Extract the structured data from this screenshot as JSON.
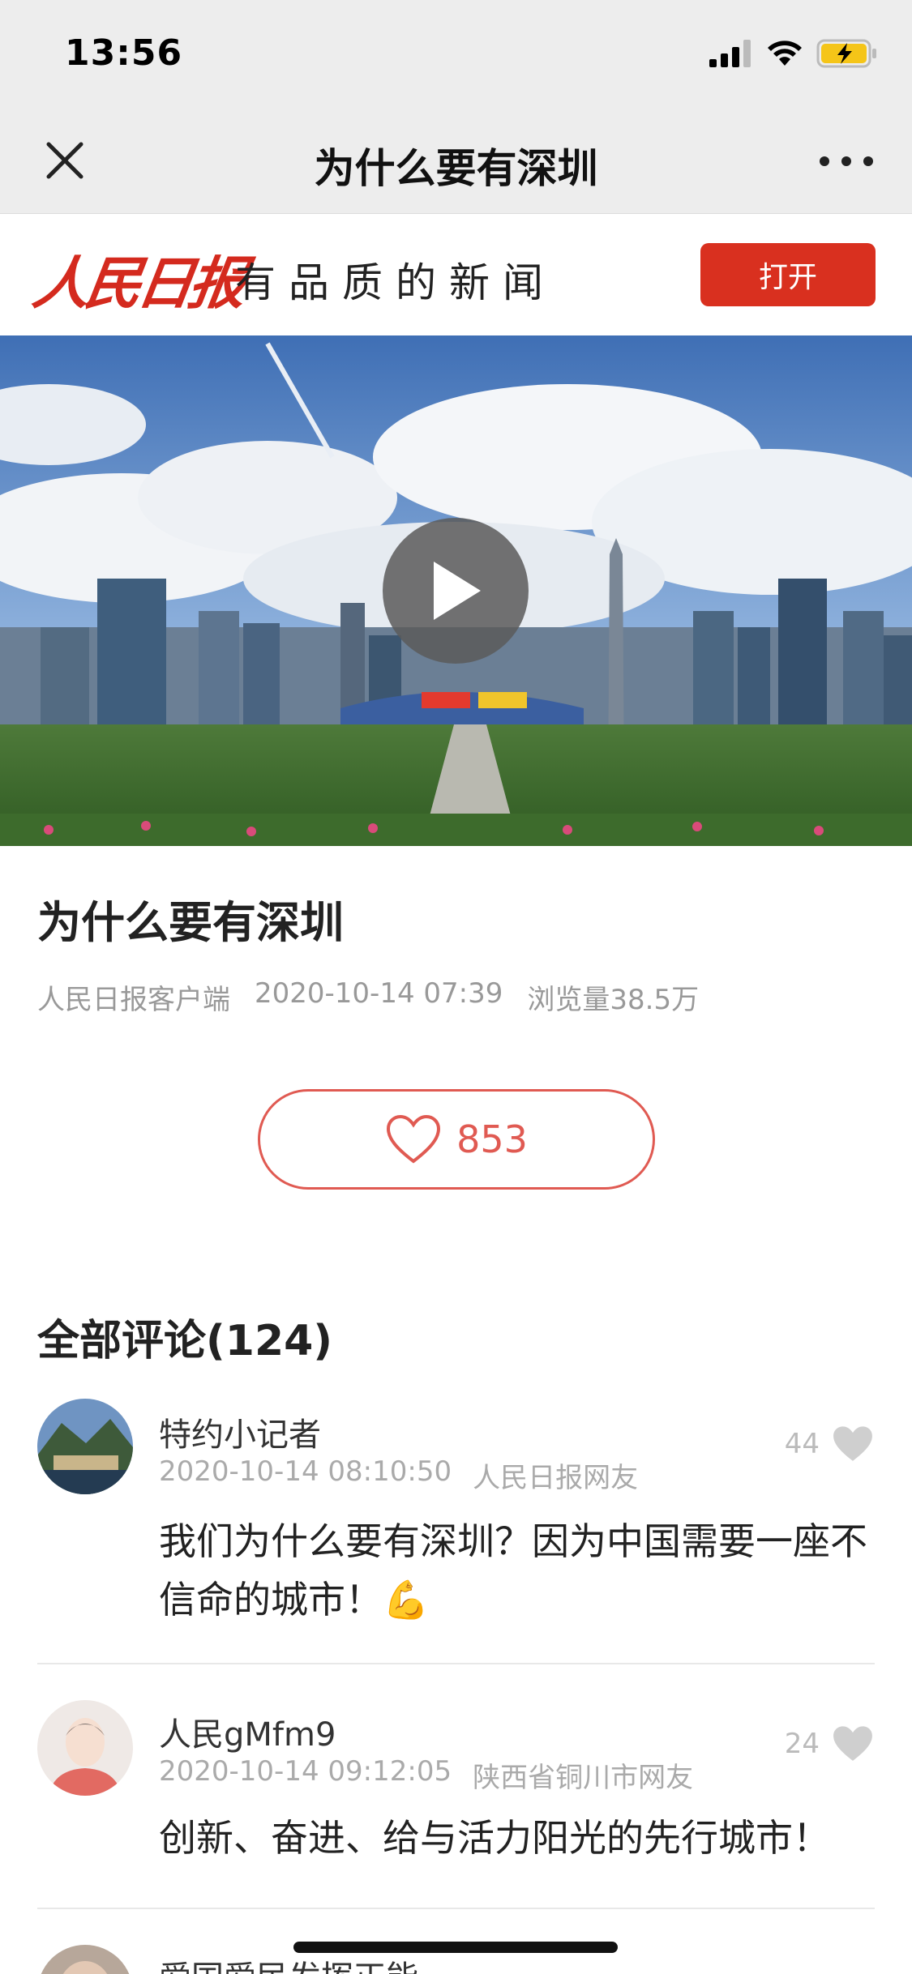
{
  "status_bar": {
    "time": "13:56"
  },
  "nav": {
    "title": "为什么要有深圳"
  },
  "brand": {
    "logo": "人民日报",
    "slogan": "有品质的新闻",
    "open_label": "打开"
  },
  "article": {
    "title": "为什么要有深圳",
    "source": "人民日报客户端",
    "datetime": "2020-10-14 07:39",
    "views": "浏览量38.5万",
    "like_count": "853"
  },
  "comments_section": {
    "heading": "全部评论(124)",
    "items": [
      {
        "name": "特约小记者",
        "time": "2020-10-14 08:10:50",
        "location": "人民日报网友",
        "likes": "44",
        "text": "我们为什么要有深圳？因为中国需要一座不信命的城市！💪"
      },
      {
        "name": "人民gMfm9",
        "time": "2020-10-14 09:12:05",
        "location": "陕西省铜川市网友",
        "likes": "24",
        "text": "创新、奋进、给与活力阳光的先行城市！"
      },
      {
        "name": "爱国爱民发挥正能"
      }
    ]
  },
  "colors": {
    "accent": "#d9301f",
    "like": "#e05a52",
    "muted": "#999999"
  },
  "icons": [
    "close-icon",
    "more-icon",
    "play-icon",
    "heart-outline-icon",
    "heart-icon"
  ]
}
